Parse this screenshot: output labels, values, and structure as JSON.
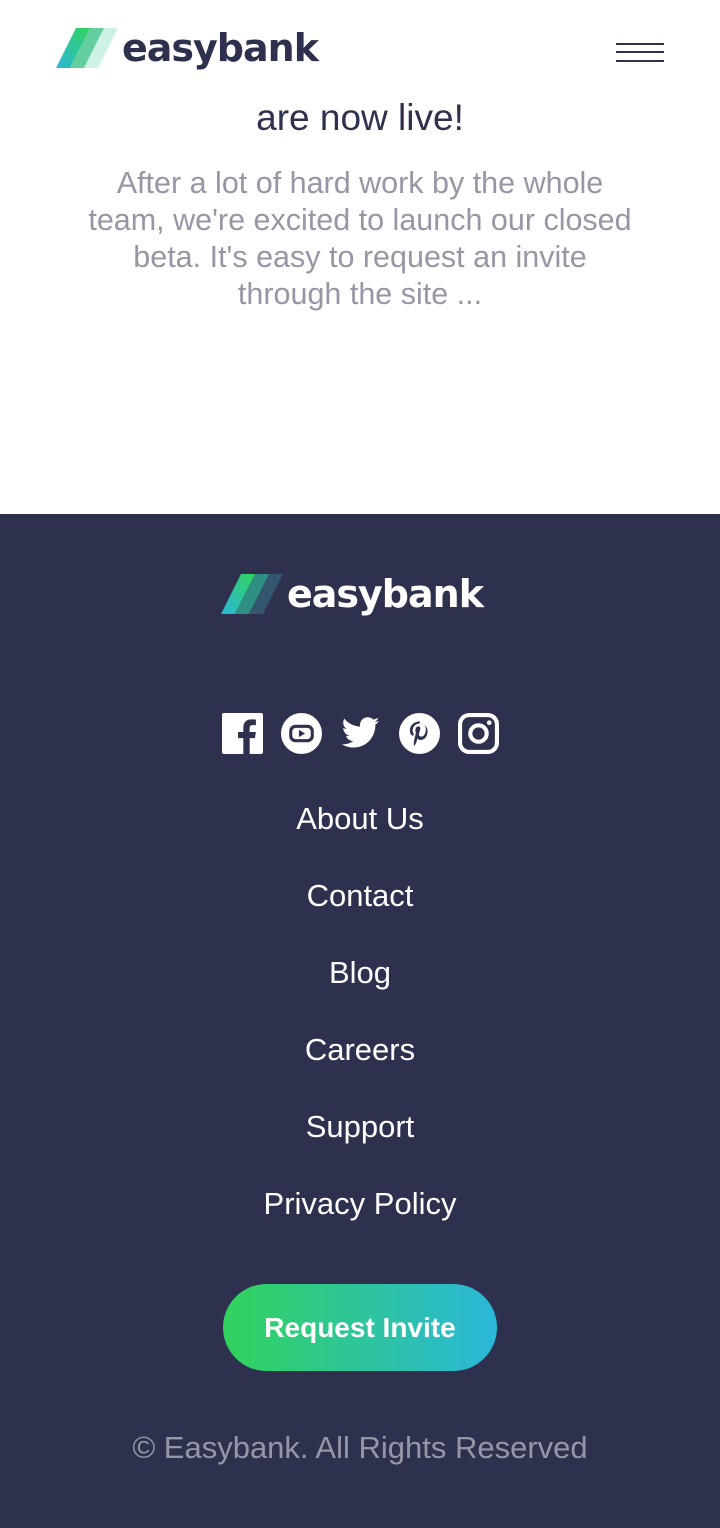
{
  "brand": {
    "name": "easybank",
    "colors": {
      "dark_blue": "#2d314d",
      "lime_green": "#31d35c",
      "bright_cyan": "#2bb7da",
      "grayish_blue": "#9597a7",
      "white": "#ffffff"
    }
  },
  "header": {
    "logo_text": "easybank",
    "menu_icon": "hamburger-icon"
  },
  "article": {
    "title": "are now live!",
    "excerpt": "After a lot of hard work by the whole team, we're excited to launch our closed beta. It's easy to request an invite through the site ..."
  },
  "footer": {
    "logo_text": "easybank",
    "social_icons": [
      "facebook-icon",
      "youtube-icon",
      "twitter-icon",
      "pinterest-icon",
      "instagram-icon"
    ],
    "links": [
      "About Us",
      "Contact",
      "Blog",
      "Careers",
      "Support",
      "Privacy Policy"
    ],
    "cta_label": "Request Invite",
    "copyright": "© Easybank. All Rights Reserved"
  }
}
